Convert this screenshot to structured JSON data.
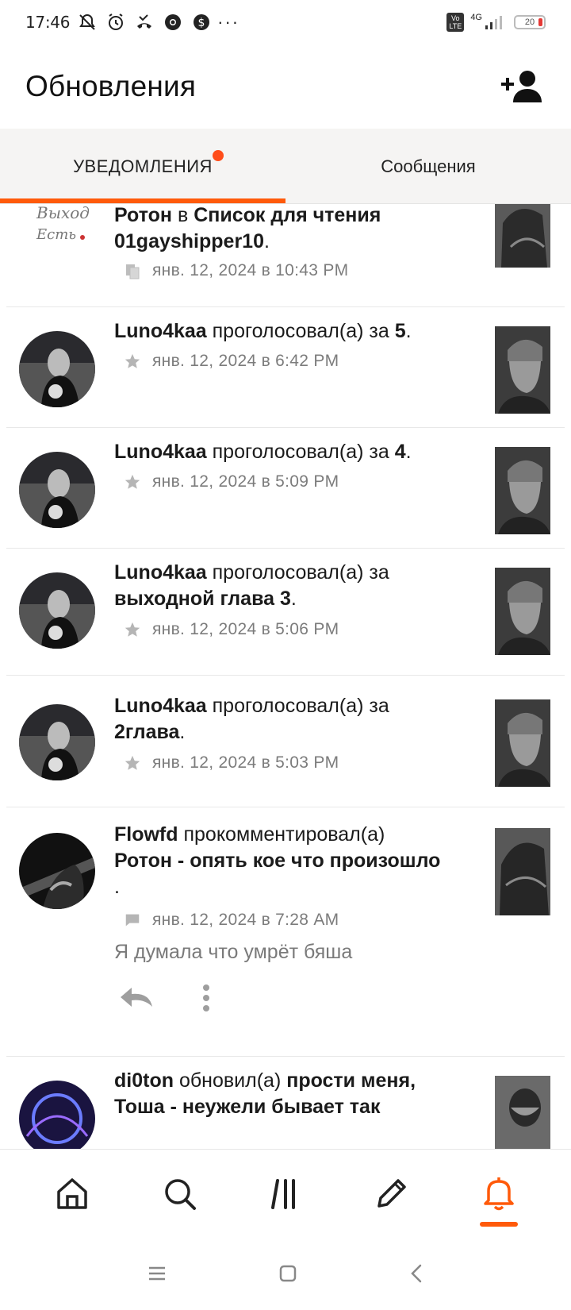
{
  "status_bar": {
    "time": "17:46",
    "signal_label": "4G",
    "volte": "Vo LTE",
    "battery": "20",
    "more": "···"
  },
  "header": {
    "title": "Обновления"
  },
  "tabs": [
    {
      "label": "УВЕДОМЛЕНИЯ",
      "active": true,
      "has_dot": true
    },
    {
      "label": "Сообщения",
      "active": false
    }
  ],
  "colors": {
    "accent": "#ff5a0a",
    "text": "#1b1b1b",
    "meta": "#7c7c7c"
  },
  "feed": [
    {
      "partial": true,
      "actor": "Ротон",
      "action": " в ",
      "target": "Список для чтения 01gayshipper10",
      "target_suffix": ".",
      "icon": "reading-list-icon",
      "timestamp": "янв. 12, 2024 в 10:43 PM"
    },
    {
      "actor": "Luno4kaa",
      "action": " проголосовал(а) за ",
      "target": "5",
      "target_suffix": ".",
      "icon": "star-icon",
      "timestamp": "янв. 12, 2024 в 6:42 PM"
    },
    {
      "actor": "Luno4kaa",
      "action": " проголосовал(а) за ",
      "target": "4",
      "target_suffix": ".",
      "icon": "star-icon",
      "timestamp": "янв. 12, 2024 в 5:09 PM"
    },
    {
      "actor": "Luno4kaa",
      "action": " проголосовал(а) за ",
      "target": "выходной глава 3",
      "target_suffix": ".",
      "icon": "star-icon",
      "timestamp": "янв. 12, 2024 в 5:06 PM"
    },
    {
      "actor": "Luno4kaa",
      "action": " проголосовал(а) за ",
      "target": "2глава",
      "target_suffix": ".",
      "icon": "star-icon",
      "timestamp": "янв. 12, 2024 в 5:03 PM"
    },
    {
      "actor": "Flowfd",
      "action": " прокомментировал(а) ",
      "target": "Ротон - опять кое что произошло",
      "target_suffix": " .",
      "icon": "comment-icon",
      "timestamp": "янв. 12, 2024 в 7:28 AM",
      "comment": "Я думала что умрёт бяша"
    },
    {
      "partial": true,
      "actor": "di0ton",
      "action": " обновил(а) ",
      "target": "прости меня, Тоша - неужели бывает так",
      "target_suffix": ""
    }
  ],
  "bottom_nav": [
    {
      "name": "home",
      "icon": "home-icon",
      "active": false
    },
    {
      "name": "search",
      "icon": "search-icon",
      "active": false
    },
    {
      "name": "library",
      "icon": "library-icon",
      "active": false
    },
    {
      "name": "write",
      "icon": "pencil-icon",
      "active": false
    },
    {
      "name": "notifications",
      "icon": "bell-icon",
      "active": true
    }
  ]
}
